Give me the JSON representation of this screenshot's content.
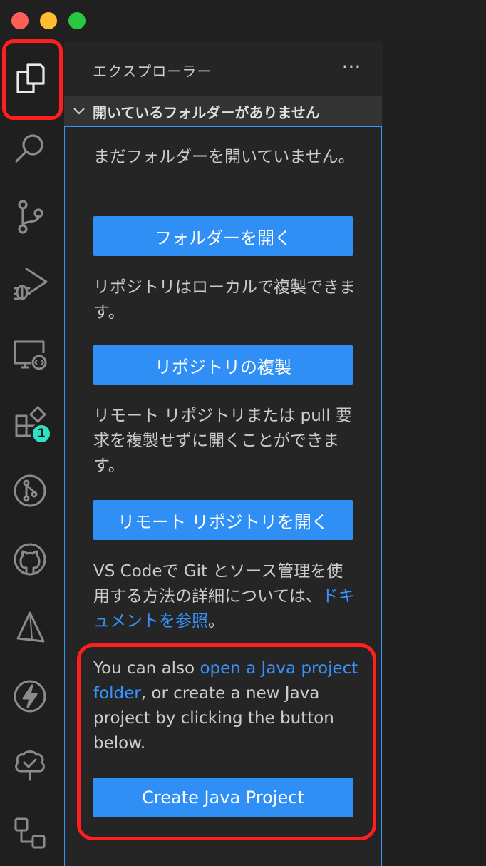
{
  "window": {
    "traffic_colors": {
      "close": "#ff5f57",
      "minimize": "#febc2e",
      "maximize": "#28c840"
    }
  },
  "activity_bar": {
    "items": [
      {
        "icon": "explorer-icon"
      },
      {
        "icon": "search-icon"
      },
      {
        "icon": "source-control-icon"
      },
      {
        "icon": "run-debug-icon"
      },
      {
        "icon": "remote-explorer-icon"
      },
      {
        "icon": "extensions-icon",
        "badge": "1"
      },
      {
        "icon": "pull-requests-icon"
      },
      {
        "icon": "github-icon"
      },
      {
        "icon": "triangle-icon"
      },
      {
        "icon": "lightning-icon"
      },
      {
        "icon": "tree-check-icon"
      },
      {
        "icon": "diagram-icon"
      }
    ]
  },
  "sidebar": {
    "title": "エクスプローラー",
    "more": "···",
    "section_title": "開いているフォルダーがありません",
    "no_folder_text": "まだフォルダーを開いていません。",
    "open_folder_button": "フォルダーを開く",
    "clone_text": "リポジトリはローカルで複製できます。",
    "clone_button": "リポジトリの複製",
    "remote_text": "リモート リポジトリまたは pull 要求を複製せずに開くことができます。",
    "remote_button": "リモート リポジトリを開く",
    "git_text_before": "VS Codeで Git とソース管理を使用する方法の詳細については、",
    "git_link": "ドキュメントを参照",
    "git_text_after": "。",
    "java_text_before": "You can also ",
    "java_link": "open a Java project folder",
    "java_text_after": ", or create a new Java project by clicking the button below.",
    "java_button": "Create Java Project"
  },
  "colors": {
    "accent": "#3794ff",
    "button": "#2f8ff4",
    "highlight": "#ff1f1f",
    "badge": "#2ee2c8"
  }
}
